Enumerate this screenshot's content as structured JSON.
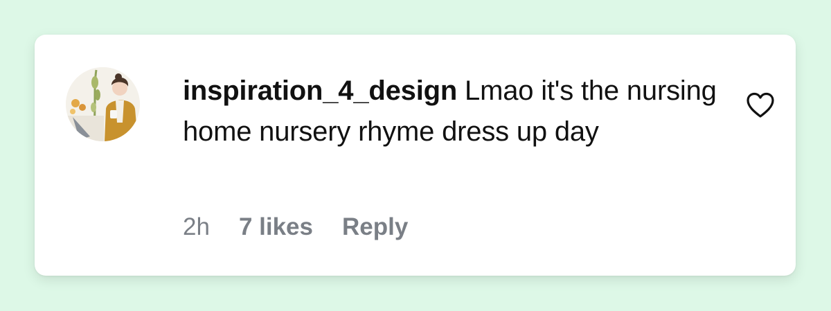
{
  "comment": {
    "username": "inspiration_4_design",
    "text": "Lmao it's the nursing home nursery rhyme dress up day",
    "time": "2h",
    "likes": "7 likes",
    "reply_label": "Reply"
  },
  "icons": {
    "like": "heart-outline-icon",
    "avatar": "profile-photo"
  },
  "colors": {
    "background": "#ddf8e7",
    "card": "#ffffff",
    "text": "#111111",
    "meta": "#7a7f86"
  }
}
